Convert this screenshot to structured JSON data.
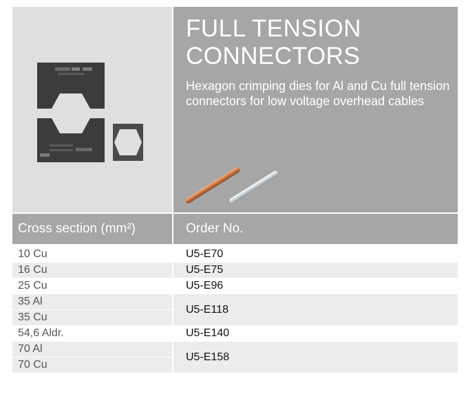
{
  "product": {
    "title": "FULL TENSION CONNECTORS",
    "description": "Hexagon crimping dies for Al and Cu full tension connectors for low voltage overhead cables"
  },
  "table": {
    "headers": [
      "Cross section (mm²)",
      "Order No."
    ],
    "rows": [
      {
        "section": "10 Cu",
        "order": "U5-E70"
      },
      {
        "section": "16 Cu",
        "order": "U5-E75"
      },
      {
        "section": "25 Cu",
        "order": "U5-E96"
      },
      {
        "section": "35 Al",
        "order": "U5-E118"
      },
      {
        "section": "35 Cu",
        "order": ""
      },
      {
        "section": "54,6 Aldr.",
        "order": "U5-E140"
      },
      {
        "section": "70 Al",
        "order": "U5-E158"
      },
      {
        "section": "70 Cu",
        "order": ""
      }
    ]
  }
}
